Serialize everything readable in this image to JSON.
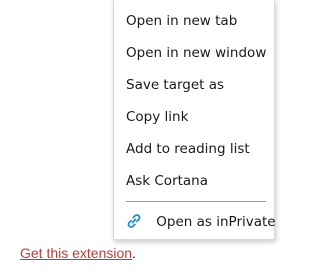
{
  "context_menu": {
    "items": [
      {
        "label": "Open in new tab"
      },
      {
        "label": "Open in new window"
      },
      {
        "label": "Save target as"
      },
      {
        "label": "Copy link"
      },
      {
        "label": "Add to reading list"
      },
      {
        "label": "Ask Cortana"
      }
    ],
    "inprivate": {
      "label": "Open as inPrivate",
      "icon": "inprivate-link-icon",
      "icon_color": "#1b8fd6"
    }
  },
  "footer": {
    "link_text": "Get this extension",
    "trailing": ".",
    "link_color": "#b0413e"
  }
}
